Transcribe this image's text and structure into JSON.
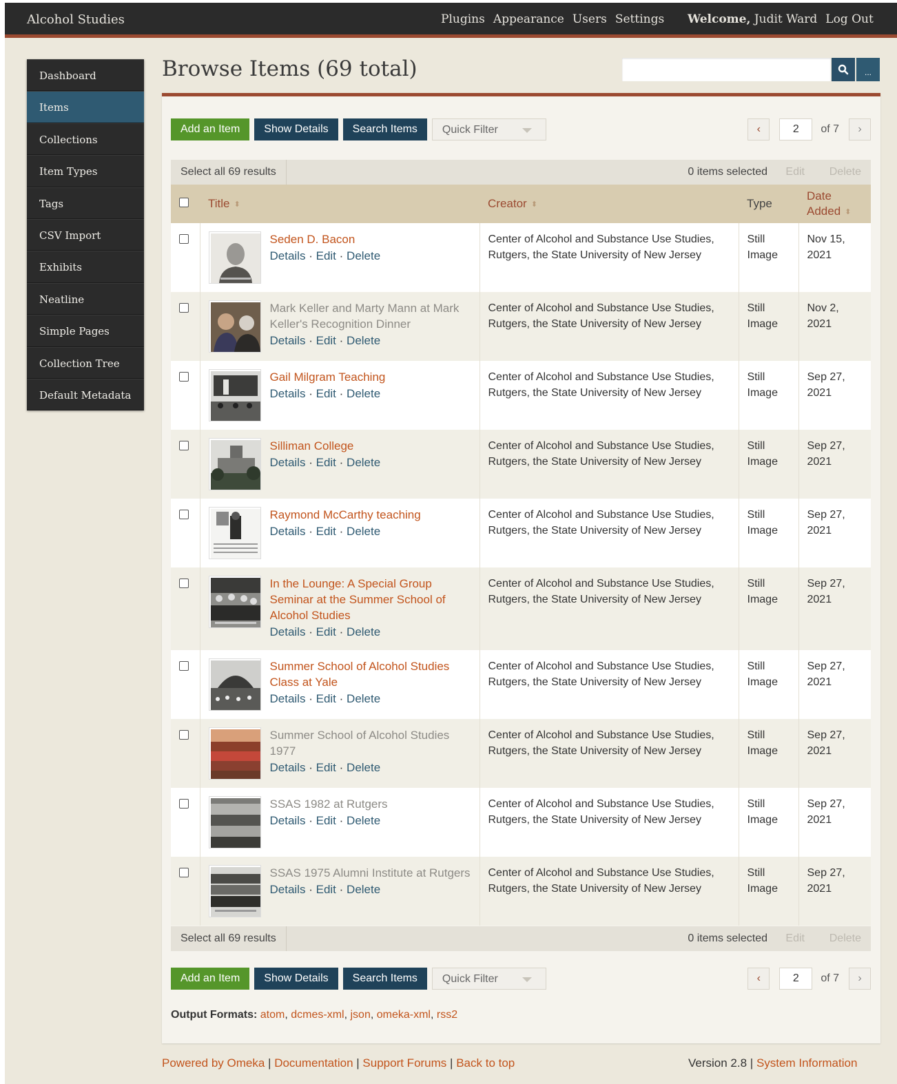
{
  "header": {
    "site_title": "Alcohol Studies",
    "nav": [
      "Plugins",
      "Appearance",
      "Users",
      "Settings"
    ],
    "welcome_label": "Welcome,",
    "user_name": "Judit Ward",
    "logout": "Log Out"
  },
  "sidebar": {
    "items": [
      {
        "label": "Dashboard"
      },
      {
        "label": "Items"
      },
      {
        "label": "Collections"
      },
      {
        "label": "Item Types"
      },
      {
        "label": "Tags"
      },
      {
        "label": "CSV Import"
      },
      {
        "label": "Exhibits"
      },
      {
        "label": "Neatline"
      },
      {
        "label": "Simple Pages"
      },
      {
        "label": "Collection Tree"
      },
      {
        "label": "Default Metadata"
      }
    ],
    "active": "Items"
  },
  "page_title": "Browse Items (69 total)",
  "search": {
    "value": "",
    "advanced_label": "..."
  },
  "toolbar": {
    "add_item": "Add an Item",
    "show_details": "Show Details",
    "search_items": "Search Items",
    "quick_filter": "Quick Filter",
    "prev": "‹",
    "next": "›",
    "page": "2",
    "of_label": "of 7"
  },
  "batch": {
    "select_all": "Select all 69 results",
    "selected": "0 items selected",
    "edit": "Edit",
    "delete": "Delete"
  },
  "columns": {
    "title": "Title",
    "creator": "Creator",
    "type": "Type",
    "date_added_1": "Date",
    "date_added_2": "Added"
  },
  "row_actions": {
    "details": "Details",
    "edit": "Edit",
    "delete": "Delete",
    "sep": "·"
  },
  "items": [
    {
      "title": "Seden D. Bacon",
      "public": true,
      "creator_1": "Center of Alcohol and Substance Use Studies,",
      "creator_2": "Rutgers, the State University of New Jersey",
      "type_1": "Still",
      "type_2": "Image",
      "date_1": "Nov 15,",
      "date_2": "2021",
      "thumb": "portrait"
    },
    {
      "title": "Mark Keller and Marty Mann at Mark Keller's Recognition Dinner",
      "public": false,
      "creator_1": "Center of Alcohol and Substance Use Studies,",
      "creator_2": "Rutgers, the State University of New Jersey",
      "type_1": "Still",
      "type_2": "Image",
      "date_1": "Nov 2,",
      "date_2": "2021",
      "thumb": "two-people"
    },
    {
      "title": "Gail Milgram Teaching",
      "public": true,
      "creator_1": "Center of Alcohol and Substance Use Studies,",
      "creator_2": "Rutgers, the State University of New Jersey",
      "type_1": "Still",
      "type_2": "Image",
      "date_1": "Sep 27,",
      "date_2": "2021",
      "thumb": "classroom"
    },
    {
      "title": "Silliman College",
      "public": true,
      "creator_1": "Center of Alcohol and Substance Use Studies,",
      "creator_2": "Rutgers, the State University of New Jersey",
      "type_1": "Still",
      "type_2": "Image",
      "date_1": "Sep 27,",
      "date_2": "2021",
      "thumb": "building"
    },
    {
      "title": "Raymond McCarthy teaching",
      "public": true,
      "creator_1": "Center of Alcohol and Substance Use Studies,",
      "creator_2": "Rutgers, the State University of New Jersey",
      "type_1": "Still",
      "type_2": "Image",
      "date_1": "Sep 27,",
      "date_2": "2021",
      "thumb": "document"
    },
    {
      "title": "In the Lounge: A Special Group Seminar at the Summer School of Alcohol Studies",
      "public": true,
      "creator_1": "Center of Alcohol and Substance Use Studies,",
      "creator_2": "Rutgers, the State University of New Jersey",
      "type_1": "Still",
      "type_2": "Image",
      "date_1": "Sep 27,",
      "date_2": "2021",
      "thumb": "lounge"
    },
    {
      "title": "Summer School of Alcohol Studies Class at Yale",
      "public": true,
      "creator_1": "Center of Alcohol and Substance Use Studies,",
      "creator_2": "Rutgers, the State University of New Jersey",
      "type_1": "Still",
      "type_2": "Image",
      "date_1": "Sep 27,",
      "date_2": "2021",
      "thumb": "auditorium"
    },
    {
      "title": "Summer School of Alcohol Studies 1977",
      "public": false,
      "creator_1": "Center of Alcohol and Substance Use Studies,",
      "creator_2": "Rutgers, the State University of New Jersey",
      "type_1": "Still",
      "type_2": "Image",
      "date_1": "Sep 27,",
      "date_2": "2021",
      "thumb": "group-color"
    },
    {
      "title": "SSAS 1982 at Rutgers",
      "public": false,
      "creator_1": "Center of Alcohol and Substance Use Studies,",
      "creator_2": "Rutgers, the State University of New Jersey",
      "type_1": "Still",
      "type_2": "Image",
      "date_1": "Sep 27,",
      "date_2": "2021",
      "thumb": "crowd"
    },
    {
      "title": "SSAS 1975 Alumni Institute at Rutgers",
      "public": false,
      "creator_1": "Center of Alcohol and Substance Use Studies,",
      "creator_2": "Rutgers, the State University of New Jersey",
      "type_1": "Still",
      "type_2": "Image",
      "date_1": "Sep 27,",
      "date_2": "2021",
      "thumb": "group-bw"
    }
  ],
  "output_formats": {
    "label": "Output Formats:",
    "formats": [
      "atom",
      "dcmes-xml",
      "json",
      "omeka-xml",
      "rss2"
    ]
  },
  "footer": {
    "powered": "Powered by Omeka",
    "documentation": "Documentation",
    "support": "Support Forums",
    "back_to_top": "Back to top",
    "version": "Version 2.8",
    "system_info": "System Information",
    "sep": "|"
  },
  "colors": {
    "header_bg": "#2b2b2b",
    "accent_rust": "#9b4a31",
    "link_orange": "#c2541c",
    "link_blue": "#2f5a72",
    "button_green": "#55962a",
    "button_navy": "#1f4259",
    "table_header": "#d8ccb0",
    "page_bg": "#ece8dc"
  },
  "icons": {
    "search": "search-icon",
    "advanced": "ellipsis-icon",
    "sort": "sort-icon",
    "dropdown": "chevron-down-icon"
  }
}
